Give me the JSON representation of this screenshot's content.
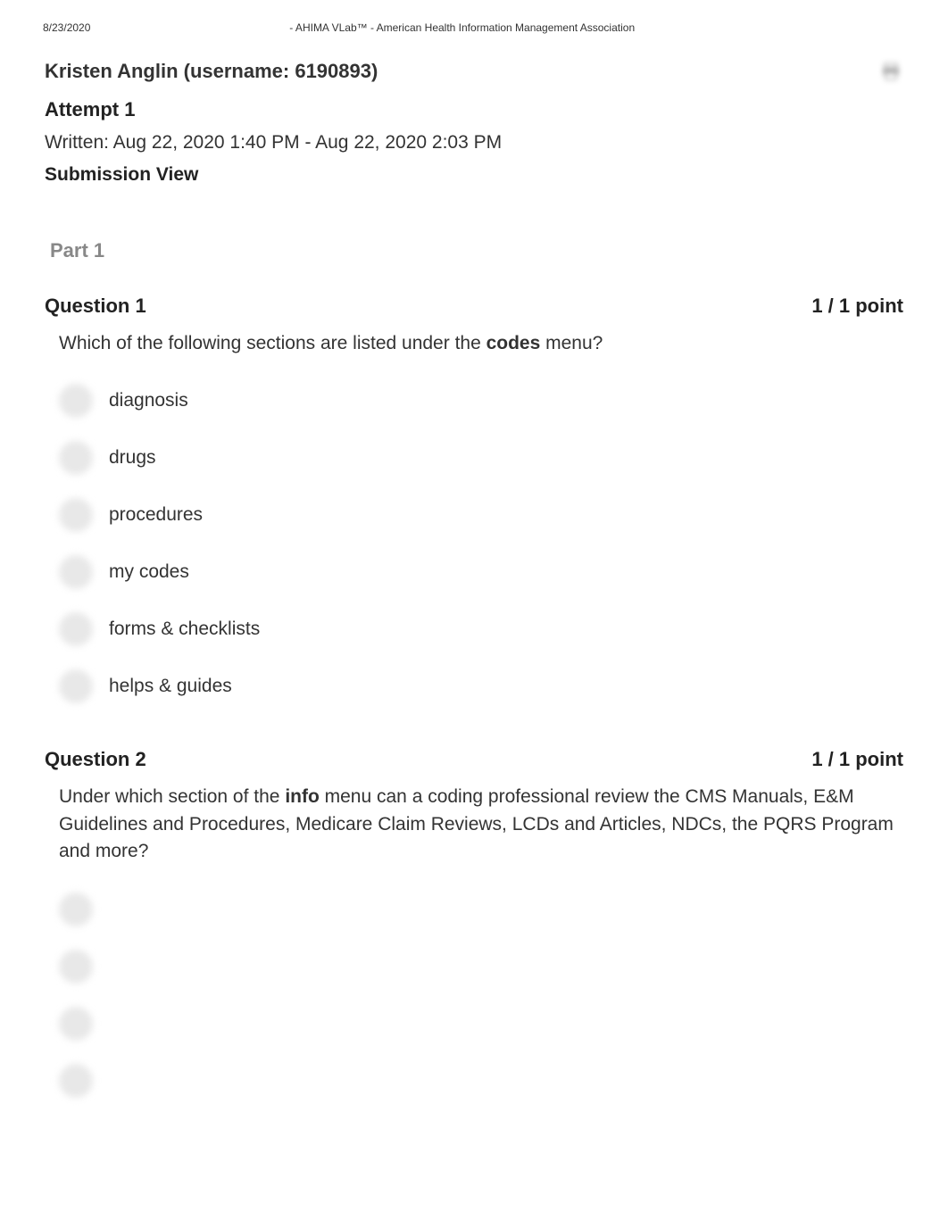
{
  "header": {
    "date": "8/23/2020",
    "title": "- AHIMA VLab™ - American Health Information Management Association"
  },
  "user": {
    "name": "Kristen Anglin",
    "username": "6190893",
    "full_line": "Kristen Anglin (username: 6190893)"
  },
  "attempt": {
    "label": "Attempt 1"
  },
  "written": {
    "label": "Written: Aug 22, 2020 1:40 PM - Aug 22, 2020 2:03 PM"
  },
  "submission": {
    "label": "Submission View"
  },
  "part": {
    "label": "Part 1"
  },
  "questions": [
    {
      "title": "Question 1",
      "points": "1 / 1 point",
      "text_before": "Which of the following sections are listed under the ",
      "text_bold": "codes",
      "text_after": " menu?",
      "options": [
        {
          "label": "diagnosis",
          "visible": true
        },
        {
          "label": "drugs",
          "visible": true
        },
        {
          "label": "procedures",
          "visible": true
        },
        {
          "label": "my codes",
          "visible": true
        },
        {
          "label": "forms & checklists",
          "visible": true
        },
        {
          "label": "helps & guides",
          "visible": true
        }
      ]
    },
    {
      "title": "Question 2",
      "points": "1 / 1 point",
      "text_before": "Under which section of the ",
      "text_bold": "info",
      "text_after": " menu can a coding professional review the CMS Manuals, E&M Guidelines and Procedures, Medicare Claim Reviews, LCDs and Articles, NDCs, the PQRS Program and more?",
      "options": [
        {
          "label": "",
          "visible": false
        },
        {
          "label": "",
          "visible": false
        },
        {
          "label": "",
          "visible": false
        },
        {
          "label": "",
          "visible": false
        }
      ]
    }
  ]
}
